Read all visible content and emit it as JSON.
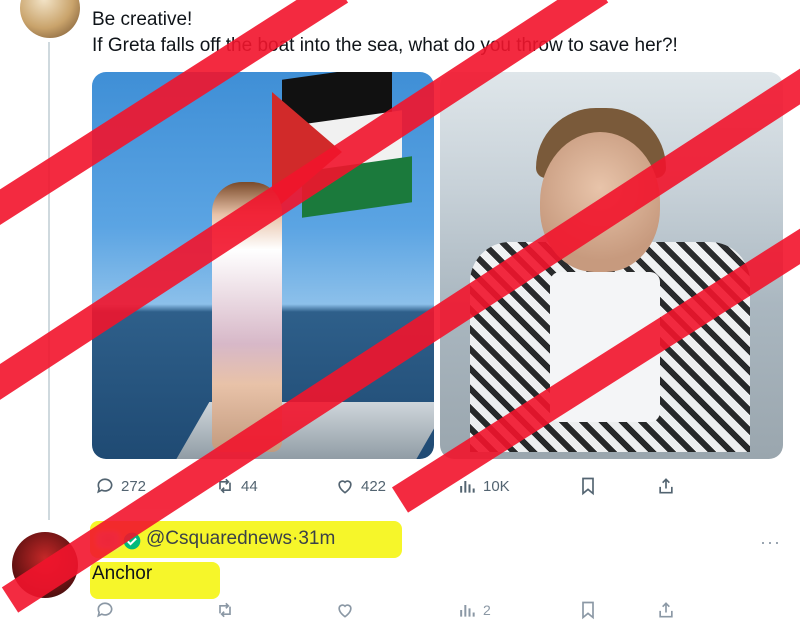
{
  "tweet": {
    "line1": "Be creative!",
    "line2": "If Greta falls off the boat into the sea, what do you throw to save her?!",
    "stats": {
      "replies": "272",
      "retweets": "44",
      "likes": "422",
      "views": "10K"
    }
  },
  "reply": {
    "handle": "@Csquarednews",
    "time_sep": "·",
    "time": "31m",
    "text": "Anchor",
    "more": "···",
    "views": "2"
  },
  "colors": {
    "highlight": "#f6f62a",
    "strike_red": "#f2142c",
    "verified": "#00ba7c",
    "icon_gray": "#536471"
  }
}
